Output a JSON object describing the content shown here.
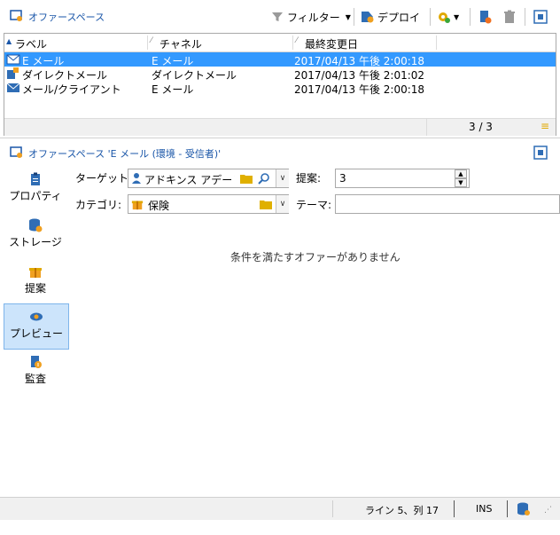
{
  "top_panel": {
    "title": "オファースペース",
    "filter_label": "フィルター",
    "deploy_label": "デプロイ"
  },
  "list": {
    "columns": [
      "ラベル",
      "チャネル",
      "最終変更日"
    ],
    "rows": [
      {
        "label": "E メール",
        "channel": "E メール",
        "modified": "2017/04/13 午後 2:00:18",
        "selected": true
      },
      {
        "label": "ダイレクトメール",
        "channel": "ダイレクトメール",
        "modified": "2017/04/13 午後 2:01:02",
        "selected": false
      },
      {
        "label": "メール/クライアント",
        "channel": "E メール",
        "modified": "2017/04/13 午後 2:00:18",
        "selected": false
      }
    ],
    "pager": "3 / 3"
  },
  "detail_panel": {
    "title": "オファースペース 'E メール (環境 - 受信者)'"
  },
  "sidebar": {
    "items": [
      {
        "label": "プロパティ",
        "icon": "clipboard-icon"
      },
      {
        "label": "ストレージ",
        "icon": "database-icon"
      },
      {
        "label": "提案",
        "icon": "gift-icon"
      },
      {
        "label": "プレビュー",
        "icon": "eye-icon"
      },
      {
        "label": "監査",
        "icon": "audit-icon"
      }
    ]
  },
  "form": {
    "target_label": "ターゲット:",
    "target_value": "アドキンス アデーレ (",
    "proposal_label": "提案:",
    "proposal_value": "3",
    "category_label": "カテゴリ:",
    "category_value": "保険",
    "theme_label": "テーマ:",
    "theme_value": ""
  },
  "message": "条件を満たすオファーがありません",
  "status": {
    "position": "ライン 5、列 17",
    "mode": "INS"
  },
  "colors": {
    "accent": "#1a56a8",
    "selection": "#3399ff",
    "sidebar_selection": "#cce4fb"
  }
}
